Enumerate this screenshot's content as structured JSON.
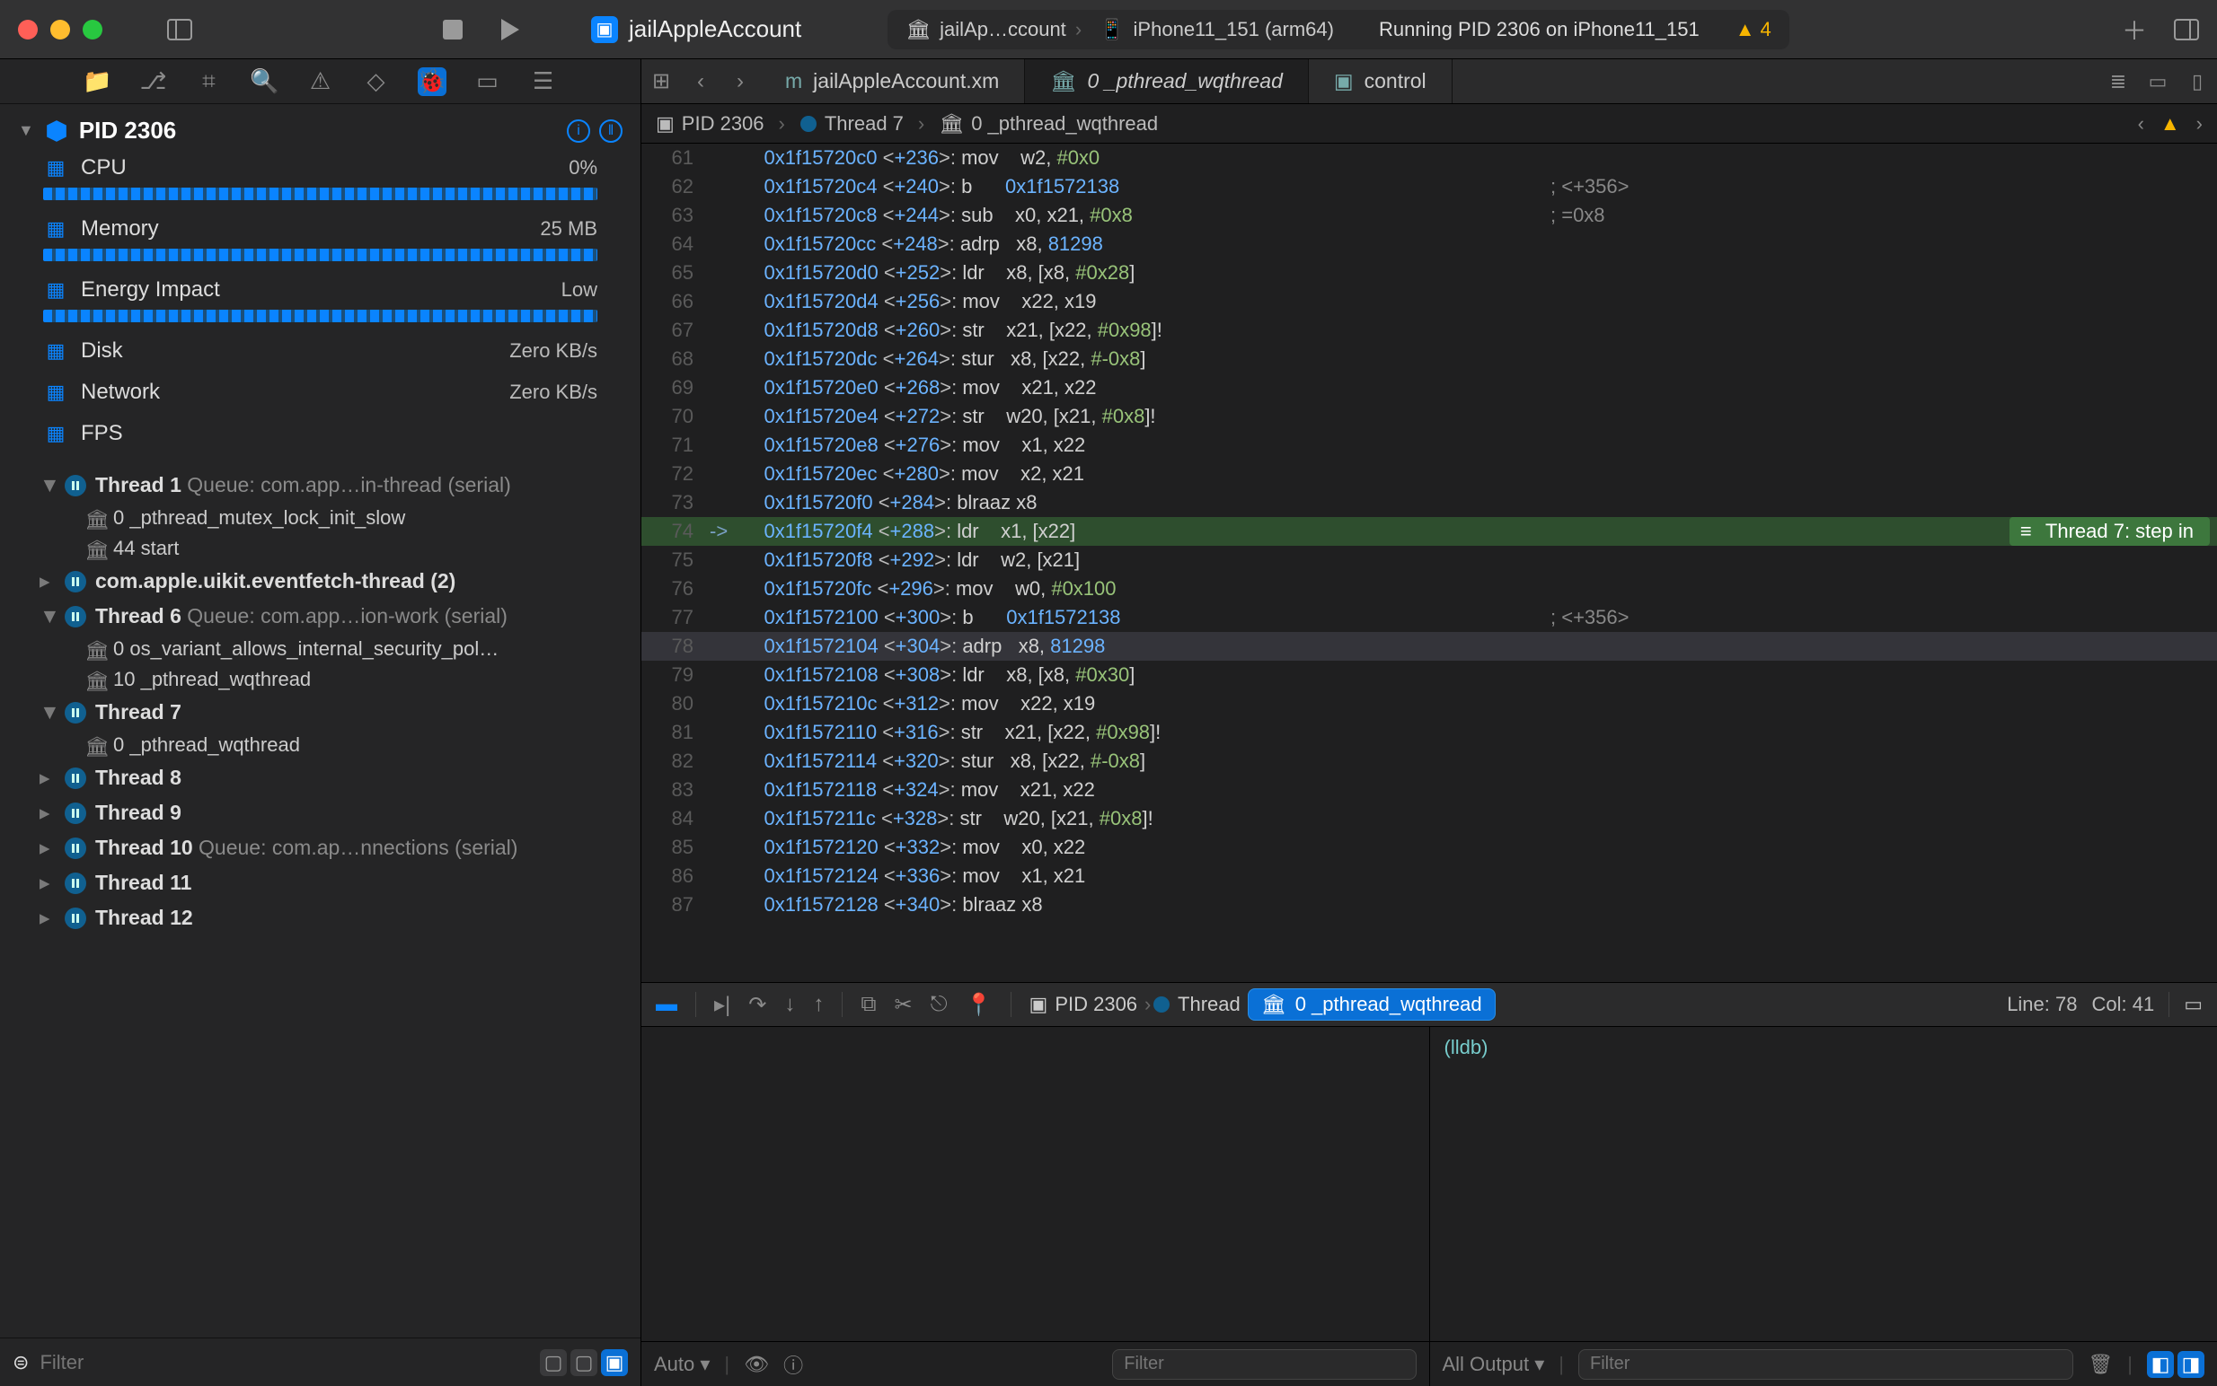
{
  "toolbar": {
    "scheme_name": "jailAppleAccount",
    "dest_target": "jailAp…ccount",
    "dest_device": "iPhone11_151 (arm64)",
    "status": "Running PID 2306 on iPhone11_151",
    "warnings": "4"
  },
  "navigator": {
    "pid_title": "PID 2306",
    "gauges": [
      {
        "label": "CPU",
        "value": "0%",
        "bar": true
      },
      {
        "label": "Memory",
        "value": "25 MB",
        "bar": true
      },
      {
        "label": "Energy Impact",
        "value": "Low",
        "bar": true
      },
      {
        "label": "Disk",
        "value": "Zero KB/s",
        "bar": false
      },
      {
        "label": "Network",
        "value": "Zero KB/s",
        "bar": false
      },
      {
        "label": "FPS",
        "value": "",
        "bar": false
      }
    ],
    "threads": [
      {
        "name": "Thread 1",
        "queue": "Queue: com.app…in-thread (serial)",
        "open": true,
        "frames": [
          "0 _pthread_mutex_lock_init_slow",
          "44 start"
        ]
      },
      {
        "name": "com.apple.uikit.eventfetch-thread (2)",
        "queue": "",
        "open": false,
        "frames": []
      },
      {
        "name": "Thread 6",
        "queue": "Queue: com.app…ion-work (serial)",
        "open": true,
        "frames": [
          "0 os_variant_allows_internal_security_pol…",
          "10 _pthread_wqthread"
        ]
      },
      {
        "name": "Thread 7",
        "queue": "",
        "open": true,
        "frames": [
          "0 _pthread_wqthread"
        ]
      },
      {
        "name": "Thread 8",
        "queue": "",
        "open": false,
        "frames": []
      },
      {
        "name": "Thread 9",
        "queue": "",
        "open": false,
        "frames": []
      },
      {
        "name": "Thread 10",
        "queue": "Queue: com.ap…nnections (serial)",
        "open": false,
        "frames": []
      },
      {
        "name": "Thread 11",
        "queue": "",
        "open": false,
        "frames": []
      },
      {
        "name": "Thread 12",
        "queue": "",
        "open": false,
        "frames": []
      }
    ],
    "filter_placeholder": "Filter"
  },
  "editor": {
    "tabs": [
      {
        "label": "jailAppleAccount.xm",
        "active": false
      },
      {
        "label": "0 _pthread_wqthread",
        "active": true,
        "italic": true
      },
      {
        "label": "control",
        "active": false
      }
    ],
    "jump": {
      "pid": "PID 2306",
      "thread": "Thread 7",
      "frame": "0 _pthread_wqthread"
    },
    "step_badge": "Thread 7: step in",
    "lines": [
      {
        "n": 61,
        "addr": "0x1f15720c0",
        "off": "+236",
        "mn": "mov",
        "args": "w2, ",
        "imm": "#0x0"
      },
      {
        "n": 62,
        "addr": "0x1f15720c4",
        "off": "+240",
        "mn": "b",
        "args": "",
        "tgt": "0x1f1572138",
        "cm": "; <+356>"
      },
      {
        "n": 63,
        "addr": "0x1f15720c8",
        "off": "+244",
        "mn": "sub",
        "args": "x0, x21, ",
        "imm": "#0x8",
        "cm": "; =0x8"
      },
      {
        "n": 64,
        "addr": "0x1f15720cc",
        "off": "+248",
        "mn": "adrp",
        "args": "x8, ",
        "tgt": "81298"
      },
      {
        "n": 65,
        "addr": "0x1f15720d0",
        "off": "+252",
        "mn": "ldr",
        "args": "x8, [x8, ",
        "imm": "#0x28",
        "post": "]"
      },
      {
        "n": 66,
        "addr": "0x1f15720d4",
        "off": "+256",
        "mn": "mov",
        "args": "x22, x19"
      },
      {
        "n": 67,
        "addr": "0x1f15720d8",
        "off": "+260",
        "mn": "str",
        "args": "x21, [x22, ",
        "imm": "#0x98",
        "post": "]!"
      },
      {
        "n": 68,
        "addr": "0x1f15720dc",
        "off": "+264",
        "mn": "stur",
        "args": "x8, [x22, ",
        "imm": "#-0x8",
        "post": "]"
      },
      {
        "n": 69,
        "addr": "0x1f15720e0",
        "off": "+268",
        "mn": "mov",
        "args": "x21, x22"
      },
      {
        "n": 70,
        "addr": "0x1f15720e4",
        "off": "+272",
        "mn": "str",
        "args": "w20, [x21, ",
        "imm": "#0x8",
        "post": "]!"
      },
      {
        "n": 71,
        "addr": "0x1f15720e8",
        "off": "+276",
        "mn": "mov",
        "args": "x1, x22"
      },
      {
        "n": 72,
        "addr": "0x1f15720ec",
        "off": "+280",
        "mn": "mov",
        "args": "x2, x21"
      },
      {
        "n": 73,
        "addr": "0x1f15720f0",
        "off": "+284",
        "mn": "blraaz",
        "args": "x8"
      },
      {
        "n": 74,
        "addr": "0x1f15720f4",
        "off": "+288",
        "mn": "ldr",
        "args": "x1, [x22]",
        "cur": true,
        "gut": "->"
      },
      {
        "n": 75,
        "addr": "0x1f15720f8",
        "off": "+292",
        "mn": "ldr",
        "args": "w2, [x21]"
      },
      {
        "n": 76,
        "addr": "0x1f15720fc",
        "off": "+296",
        "mn": "mov",
        "args": "w0, ",
        "imm": "#0x100"
      },
      {
        "n": 77,
        "addr": "0x1f1572100",
        "off": "+300",
        "mn": "b",
        "args": "",
        "tgt": "0x1f1572138",
        "cm": "; <+356>"
      },
      {
        "n": 78,
        "addr": "0x1f1572104",
        "off": "+304",
        "mn": "adrp",
        "args": "x8, ",
        "tgt": "81298",
        "sel": true,
        "cursor": true
      },
      {
        "n": 79,
        "addr": "0x1f1572108",
        "off": "+308",
        "mn": "ldr",
        "args": "x8, [x8, ",
        "imm": "#0x30",
        "post": "]"
      },
      {
        "n": 80,
        "addr": "0x1f157210c",
        "off": "+312",
        "mn": "mov",
        "args": "x22, x19"
      },
      {
        "n": 81,
        "addr": "0x1f1572110",
        "off": "+316",
        "mn": "str",
        "args": "x21, [x22, ",
        "imm": "#0x98",
        "post": "]!"
      },
      {
        "n": 82,
        "addr": "0x1f1572114",
        "off": "+320",
        "mn": "stur",
        "args": "x8, [x22, ",
        "imm": "#-0x8",
        "post": "]"
      },
      {
        "n": 83,
        "addr": "0x1f1572118",
        "off": "+324",
        "mn": "mov",
        "args": "x21, x22"
      },
      {
        "n": 84,
        "addr": "0x1f157211c",
        "off": "+328",
        "mn": "str",
        "args": "w20, [x21, ",
        "imm": "#0x8",
        "post": "]!"
      },
      {
        "n": 85,
        "addr": "0x1f1572120",
        "off": "+332",
        "mn": "mov",
        "args": "x0, x22"
      },
      {
        "n": 86,
        "addr": "0x1f1572124",
        "off": "+336",
        "mn": "mov",
        "args": "x1, x21"
      },
      {
        "n": 87,
        "addr": "0x1f1572128",
        "off": "+340",
        "mn": "blraaz",
        "args": "x8"
      }
    ]
  },
  "debugbar": {
    "pid": "PID 2306",
    "thread": "Thread",
    "frame": "0 _pthread_wqthread",
    "line": "Line: 78",
    "col": "Col: 41"
  },
  "variables": {
    "scope": "Auto",
    "filter_placeholder": "Filter"
  },
  "console": {
    "prompt": "(lldb)",
    "output_mode": "All Output",
    "filter_placeholder": "Filter"
  }
}
